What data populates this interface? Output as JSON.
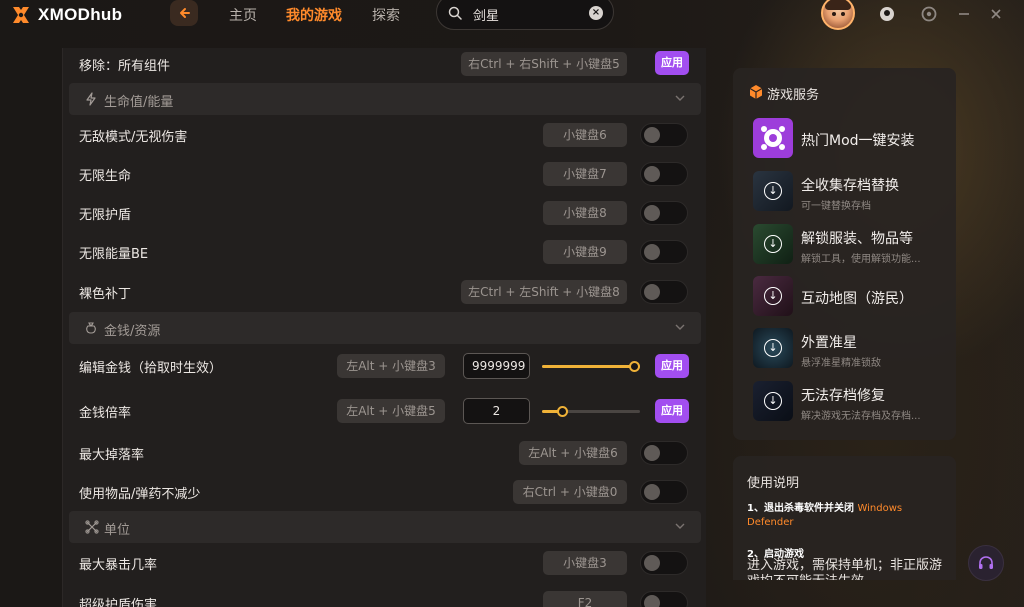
{
  "app": {
    "name": "XMODhub"
  },
  "nav": {
    "items": [
      {
        "label": "主页",
        "active": false
      },
      {
        "label": "我的游戏",
        "active": true
      },
      {
        "label": "探索",
        "active": false
      }
    ]
  },
  "search": {
    "value": "剑星"
  },
  "colors": {
    "accent": "#ff8a2b",
    "apply": "#a24ef0",
    "slider": "#f0b238",
    "panel": "#221f1e"
  },
  "rows": {
    "remove_all": {
      "label": "移除：所有组件",
      "key": "右Ctrl + 右Shift + 小键盘5",
      "apply": "应用"
    },
    "section_health": {
      "label": "生命值/能量",
      "icon": "lightning-icon"
    },
    "god_mode": {
      "label": "无敌模式/无视伤害",
      "key": "小键盘6",
      "enabled": false
    },
    "inf_health": {
      "label": "无限生命",
      "key": "小键盘7",
      "enabled": false
    },
    "inf_shield": {
      "label": "无限护盾",
      "key": "小键盘8",
      "enabled": false
    },
    "inf_energy": {
      "label": "无限能量BE",
      "key": "小键盘9",
      "enabled": false
    },
    "nude_patch": {
      "label": "裸色补丁",
      "key": "左Ctrl + 左Shift + 小键盘8",
      "enabled": false
    },
    "section_money": {
      "label": "金钱/资源",
      "icon": "money-bag-icon"
    },
    "edit_money": {
      "label": "编辑金钱（拾取时生效）",
      "key": "左Alt + 小键盘3",
      "value": "9999999",
      "slider_fraction": 1.0,
      "apply": "应用"
    },
    "money_mult": {
      "label": "金钱倍率",
      "key": "左Alt + 小键盘5",
      "value": "2",
      "slider_fraction": 0.2,
      "apply": "应用"
    },
    "max_drop": {
      "label": "最大掉落率",
      "key": "左Alt + 小键盘6",
      "enabled": false
    },
    "no_consume": {
      "label": "使用物品/弹药不减少",
      "key": "右Ctrl + 小键盘0",
      "enabled": false
    },
    "section_unit": {
      "label": "单位",
      "icon": "unit-icon"
    },
    "max_crit": {
      "label": "最大暴击几率",
      "key": "小键盘3",
      "enabled": false
    },
    "super_shield": {
      "label": "超级护盾伤害",
      "key": "F2",
      "enabled": false
    }
  },
  "services": {
    "title": "游戏服务",
    "items": [
      {
        "name": "热门Mod一键安装",
        "sub": ""
      },
      {
        "name": "全收集存档替换",
        "sub": "可一键替换存档"
      },
      {
        "name": "解锁服装、物品等",
        "sub": "解锁工具，使用解锁功能..."
      },
      {
        "name": "互动地图（游民）",
        "sub": ""
      },
      {
        "name": "外置准星",
        "sub": "悬浮准星精准锁敌"
      },
      {
        "name": "无法存档修复",
        "sub": "解决游戏无法存档及存档..."
      }
    ]
  },
  "help": {
    "title": "使用说明",
    "step1": "1、退出杀毒软件并关闭",
    "step1_highlight": "Windows Defender",
    "step2": "2、启动游戏",
    "step2_body": "进入游戏，需保持单机；非正版游戏均不可能无法生效"
  }
}
